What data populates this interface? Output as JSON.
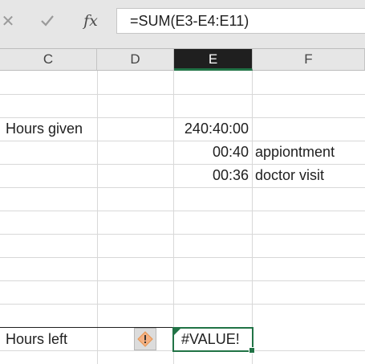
{
  "formula_bar": {
    "cancel_icon": "✕",
    "formula": "=SUM(E3-E4:E11)"
  },
  "columns": [
    {
      "letter": "C",
      "selected": false
    },
    {
      "letter": "D",
      "selected": false
    },
    {
      "letter": "E",
      "selected": true
    },
    {
      "letter": "F",
      "selected": false
    }
  ],
  "cells": {
    "hours_given_label": "Hours given",
    "hours_given_value": "240:40:00",
    "entry1_time": "00:40",
    "entry1_note": "appiontment",
    "entry2_time": "00:36",
    "entry2_note": "doctor visit",
    "hours_left_label": "Hours left",
    "hours_left_value": "#VALUE!"
  },
  "error_indicator": {
    "icon": "warning-icon",
    "color": "#f4b183"
  },
  "accent": "#217346"
}
